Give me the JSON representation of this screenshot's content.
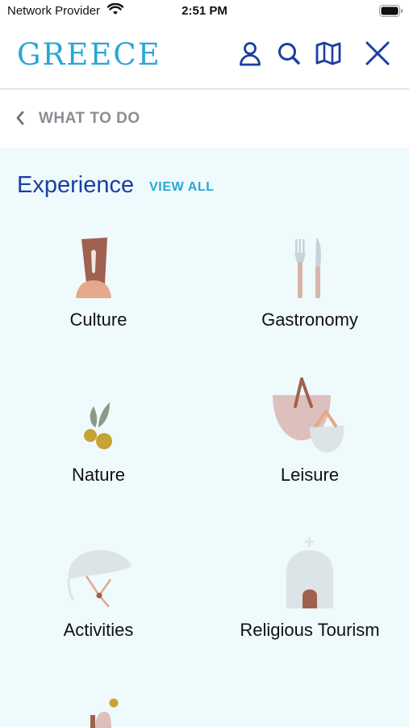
{
  "status_bar": {
    "carrier": "Network Provider",
    "time": "2:51 PM"
  },
  "header": {
    "logo": "GREECE",
    "icons": [
      "user-icon",
      "search-icon",
      "map-icon",
      "close-icon"
    ],
    "accent_color": "#1b3fa0",
    "logo_color": "#2aa7d6"
  },
  "breadcrumb": {
    "back_label": "WHAT TO DO"
  },
  "section": {
    "title": "Experience",
    "view_all": "VIEW ALL",
    "items": [
      {
        "label": "Culture",
        "icon": "culture-icon"
      },
      {
        "label": "Gastronomy",
        "icon": "gastronomy-icon"
      },
      {
        "label": "Nature",
        "icon": "nature-icon"
      },
      {
        "label": "Leisure",
        "icon": "leisure-icon"
      },
      {
        "label": "Activities",
        "icon": "activities-icon"
      },
      {
        "label": "Religious Tourism",
        "icon": "religious-tourism-icon"
      }
    ]
  }
}
